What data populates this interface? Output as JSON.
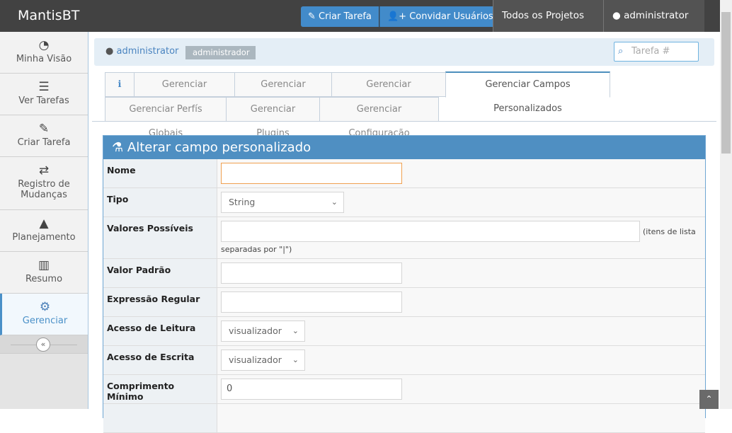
{
  "navbar": {
    "brand": "MantisBT",
    "create_task": "Criar Tarefa",
    "invite_users": "Convidar Usuários",
    "projects": "Todos os Projetos",
    "user": "administrator"
  },
  "sidebar": {
    "items": [
      {
        "label": "Minha Visão"
      },
      {
        "label": "Ver Tarefas"
      },
      {
        "label": "Criar Tarefa"
      },
      {
        "label": "Registro de Mudanças"
      },
      {
        "label": "Planejamento"
      },
      {
        "label": "Resumo"
      },
      {
        "label": "Gerenciar"
      }
    ]
  },
  "breadcrumb": {
    "user": "administrator",
    "role": "administrador",
    "search_placeholder": "Tarefa #"
  },
  "tabs": {
    "row1": [
      "Gerenciar Usuários",
      "Gerenciar Projetos",
      "Gerenciar Marcadores",
      "Gerenciar Campos Personalizados"
    ],
    "row2": [
      "Gerenciar Perfís Globais",
      "Gerenciar Plugins",
      "Gerenciar Configuração"
    ]
  },
  "form": {
    "title": "Alterar campo personalizado",
    "fields": {
      "name": {
        "label": "Nome",
        "value": ""
      },
      "type": {
        "label": "Tipo",
        "value": "String"
      },
      "possible": {
        "label": "Valores Possíveis",
        "hint1": "(itens de lista",
        "hint2": "separadas por \"|\")"
      },
      "default": {
        "label": "Valor Padrão",
        "value": ""
      },
      "regex": {
        "label": "Expressão Regular",
        "value": ""
      },
      "read": {
        "label": "Acesso de Leitura",
        "value": "visualizador"
      },
      "write": {
        "label": "Acesso de Escrita",
        "value": "visualizador"
      },
      "minlen": {
        "label": "Comprimento Mínimo",
        "value": "0"
      }
    }
  }
}
